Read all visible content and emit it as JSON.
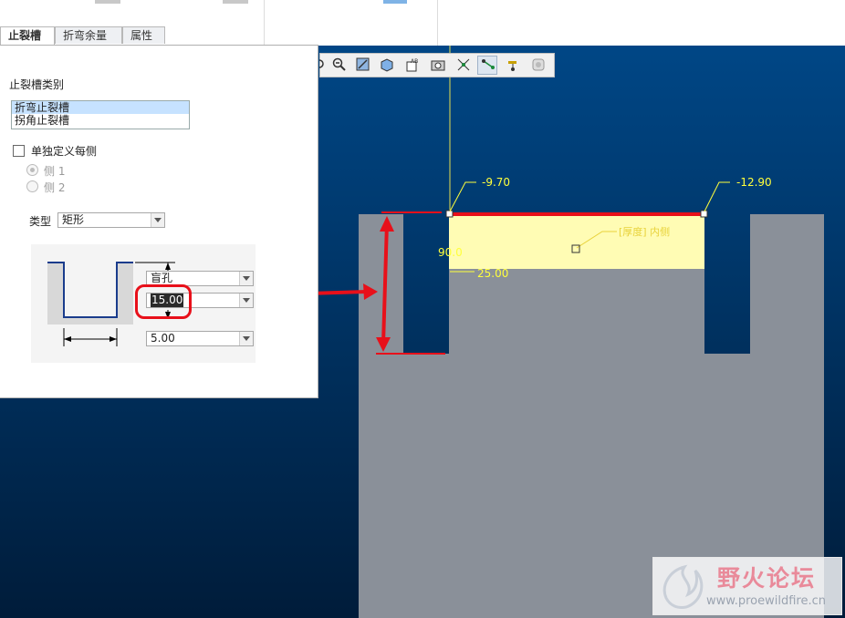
{
  "tabs": [
    "止裂槽",
    "折弯余量",
    "属性"
  ],
  "panel": {
    "relief_type_label": "止裂槽类别",
    "relief_types": [
      "折弯止裂槽",
      "拐角止裂槽"
    ],
    "define_each_side": "单独定义每侧",
    "side1": "侧 1",
    "side2": "侧 2",
    "type_label": "类型",
    "type_value": "矩形",
    "depth_option": "盲孔",
    "depth_value": "15.00",
    "width_value": "5.00"
  },
  "toolbar": {
    "icons": [
      "zoom-partial-icon",
      "zoom-out-icon",
      "refit-icon",
      "shaded-view-icon",
      "view-orient-icon",
      "saved-views-icon",
      "datum-display-icon",
      "datum-axis-icon",
      "datum-point-icon",
      "csys-icon"
    ]
  },
  "model": {
    "dim_left": "-9.70",
    "dim_right": "-12.90",
    "dim_angle": "90.0",
    "dim_depth": "25.00",
    "note": "[厚度] 内侧"
  },
  "watermark": {
    "title": "野火论坛",
    "url": "www.proewildfire.cn"
  },
  "colors": {
    "background_top": "#004a8c",
    "background_bottom": "#001c3a",
    "part": "#8a9099",
    "highlight": "#fffcb4",
    "annotation": "#e8101a"
  }
}
